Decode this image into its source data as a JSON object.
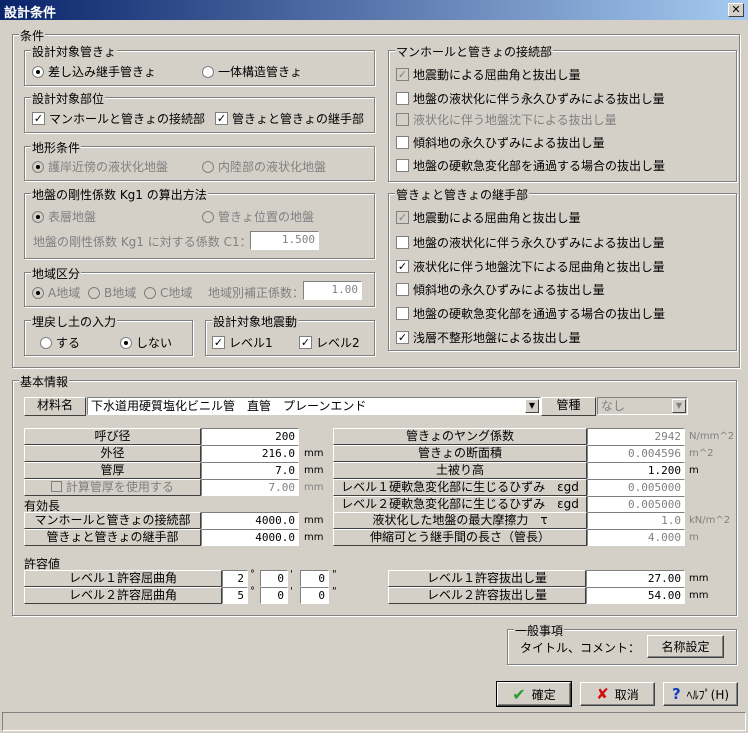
{
  "title": "設計条件",
  "close": "✕",
  "cond": {
    "label": "条件",
    "pipe": {
      "label": "設計対象管きょ",
      "opts": [
        "差し込み継手管きょ",
        "一体構造管きょ"
      ],
      "selected": 0
    },
    "part": {
      "label": "設計対象部位",
      "opts": [
        "マンホールと管きょの接続部",
        "管きょと管きょの継手部"
      ],
      "checked": [
        true,
        true
      ]
    },
    "terrain": {
      "label": "地形条件",
      "opts": [
        "護岸近傍の液状化地盤",
        "内陸部の液状化地盤"
      ],
      "selected": 0
    },
    "kg": {
      "label": "地盤の剛性係数 Kg1 の算出方法",
      "opts": [
        "表層地盤",
        "管きょ位置の地盤"
      ],
      "selected": 0,
      "coef_label": "地盤の剛性係数 Kg1 に対する係数 C1：",
      "coef": "1.500"
    },
    "region": {
      "label": "地域区分",
      "opts": [
        "A地域",
        "B地域",
        "C地域"
      ],
      "selected": 0,
      "corr_label": "地域別補正係数：",
      "corr": "1.00"
    },
    "backfill": {
      "label": "埋戻し土の入力",
      "opts": [
        "する",
        "しない"
      ],
      "selected": 1
    },
    "quake": {
      "label": "設計対象地震動",
      "opts": [
        "レベル1",
        "レベル2"
      ],
      "checked": [
        true,
        true
      ]
    },
    "mh": {
      "label": "マンホールと管きょの接続部",
      "items": [
        "地震動による屈曲角と抜出し量",
        "地盤の液状化に伴う永久ひずみによる抜出し量",
        "液状化に伴う地盤沈下による抜出し量",
        "傾斜地の永久ひずみによる抜出し量",
        "地盤の硬軟急変化部を通過する場合の抜出し量"
      ]
    },
    "jt": {
      "label": "管きょと管きょの継手部",
      "items": [
        "地震動による屈曲角と抜出し量",
        "地盤の液状化に伴う永久ひずみによる抜出し量",
        "液状化に伴う地盤沈下による屈曲角と抜出し量",
        "傾斜地の永久ひずみによる抜出し量",
        "地盤の硬軟急変化部を通過する場合の抜出し量",
        "浅層不整形地盤による抜出し量"
      ]
    }
  },
  "basic": {
    "label": "基本情報",
    "material_label": "材料名",
    "material": "下水道用硬質塩化ビニル管　直管　プレーンエンド",
    "kind_label": "管種",
    "kind": "なし",
    "left": [
      {
        "label": "呼び径",
        "value": "200",
        "unit": ""
      },
      {
        "label": "外径",
        "value": "216.0",
        "unit": "mm"
      },
      {
        "label": "管厚",
        "value": "7.0",
        "unit": "mm"
      },
      {
        "label": "計算管厚を使用する",
        "value": "7.00",
        "unit": "mm"
      }
    ],
    "eff_label": "有効長",
    "eff": [
      {
        "label": "マンホールと管きょの接続部",
        "value": "4000.0",
        "unit": "mm"
      },
      {
        "label": "管きょと管きょの継手部",
        "value": "4000.0",
        "unit": "mm"
      }
    ],
    "right": [
      {
        "label": "管きょのヤング係数",
        "value": "2942",
        "unit": "N/mm^2"
      },
      {
        "label": "管きょの断面積",
        "value": "0.004596",
        "unit": "m^2"
      },
      {
        "label": "土被り高",
        "value": "1.200",
        "unit": "m"
      },
      {
        "label": "レベル１硬軟急変化部に生じるひずみ　εgd",
        "value": "0.005000",
        "unit": ""
      },
      {
        "label": "レベル２硬軟急変化部に生じるひずみ　εgd",
        "value": "0.005000",
        "unit": ""
      },
      {
        "label": "液状化した地盤の最大摩擦力　τ",
        "value": "1.0",
        "unit": "kN/m^2"
      },
      {
        "label": "伸縮可とう継手間の長さ（管長）",
        "value": "4.000",
        "unit": "m"
      }
    ],
    "allow_label": "許容値",
    "angles": [
      {
        "label": "レベル１許容屈曲角",
        "deg": "2",
        "min": "0",
        "sec": "0"
      },
      {
        "label": "レベル２許容屈曲角",
        "deg": "5",
        "min": "0",
        "sec": "0"
      }
    ],
    "sym": {
      "deg": "°",
      "min": "'",
      "sec": "\""
    },
    "pull": [
      {
        "label": "レベル１許容抜出し量",
        "value": "27.00",
        "unit": "mm"
      },
      {
        "label": "レベル２許容抜出し量",
        "value": "54.00",
        "unit": "mm"
      }
    ]
  },
  "general": {
    "label": "一般事項",
    "text": "タイトル、コメント：",
    "button": "名称設定"
  },
  "buttons": {
    "ok": "確定",
    "cancel": "取消",
    "help": "ﾍﾙﾌﾟ(H)"
  }
}
